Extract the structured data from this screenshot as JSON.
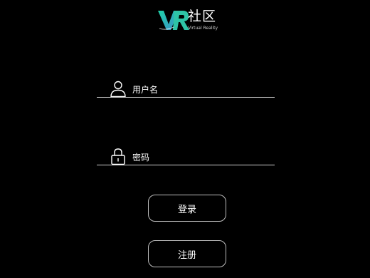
{
  "logo": {
    "title": "社区",
    "subtitle": "Virtual Reality",
    "colors": {
      "v_gradient_start": "#1fd1a8",
      "v_gradient_end": "#3b8fc9",
      "r_color": "#2ec4a6"
    }
  },
  "form": {
    "username": {
      "icon": "user-icon",
      "placeholder": "用户名",
      "value": ""
    },
    "password": {
      "icon": "lock-icon",
      "placeholder": "密码",
      "value": ""
    }
  },
  "buttons": {
    "login_label": "登录",
    "register_label": "注册"
  },
  "theme": {
    "background": "#000000",
    "text": "#ffffff",
    "line": "#cfcfcf",
    "button_border": "#bdbdbd"
  }
}
